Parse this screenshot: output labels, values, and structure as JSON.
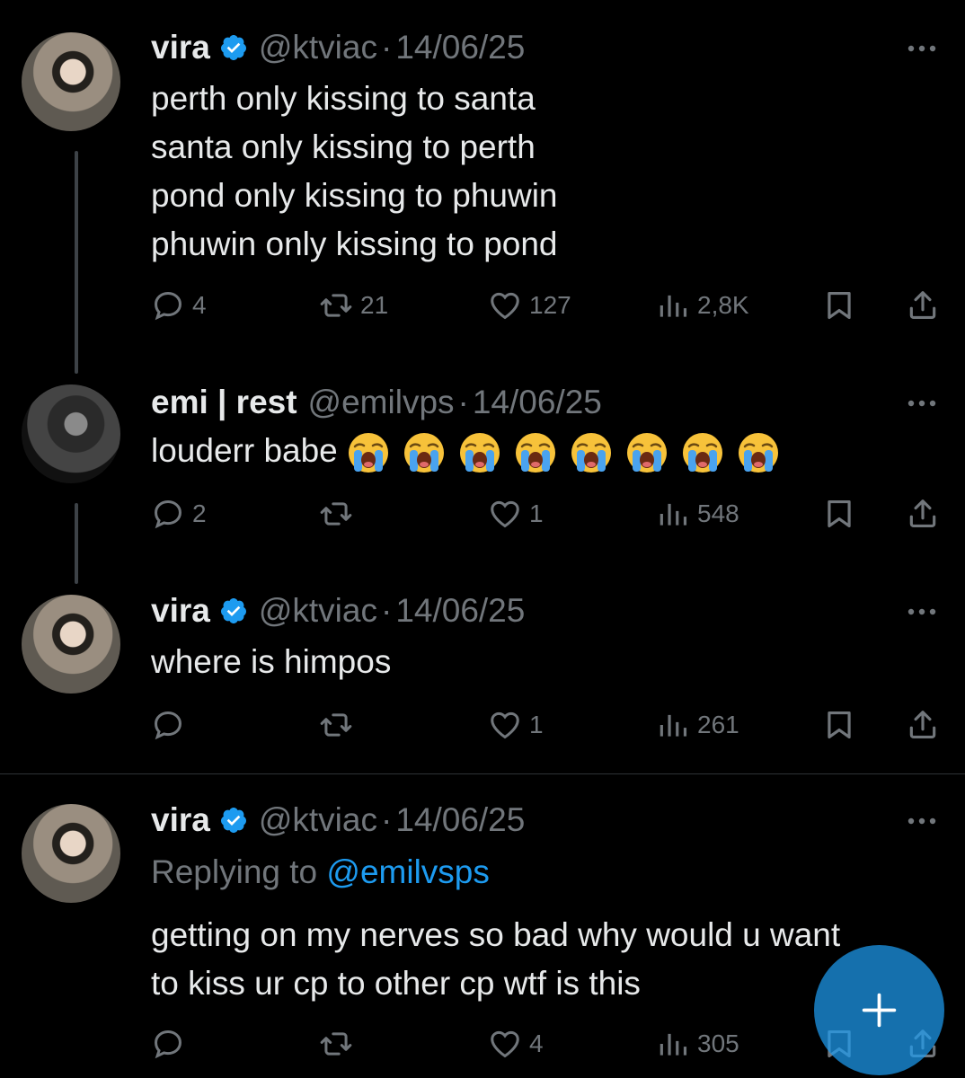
{
  "tweets": [
    {
      "name": "vira",
      "handle": "@ktviac",
      "dot": "·",
      "date": "14/06/25",
      "lines": [
        "perth only kissing to santa",
        "santa only kissing to perth",
        "pond only kissing to phuwin",
        "phuwin only kissing to pond"
      ],
      "replies": "4",
      "reposts": "21",
      "likes": "127",
      "views": "2,8K"
    },
    {
      "name": "emi | rest",
      "handle": "@emilvps",
      "dot": "·",
      "date": "14/06/25",
      "text": "louderr babe",
      "emoji": "loudly-crying-face",
      "emoji_count": 8,
      "replies": "2",
      "reposts": "",
      "likes": "1",
      "views": "548"
    },
    {
      "name": "vira",
      "handle": "@ktviac",
      "dot": "·",
      "date": "14/06/25",
      "text": "where is himpos",
      "replies": "",
      "reposts": "",
      "likes": "1",
      "views": "261"
    },
    {
      "name": "vira",
      "handle": "@ktviac",
      "dot": "·",
      "date": "14/06/25",
      "replying_prefix": "Replying to",
      "replying_to": "@emilvsps",
      "lines": [
        "getting on my nerves so bad why would u want",
        "to kiss ur cp to other cp wtf is this"
      ],
      "replies": "",
      "reposts": "",
      "likes": "4",
      "views": "305"
    }
  ],
  "colors": {
    "background": "#000000",
    "text": "#e7e9ea",
    "muted": "#71767b",
    "accent": "#1d9bf0"
  },
  "fab": {
    "icon": "plus-icon"
  }
}
